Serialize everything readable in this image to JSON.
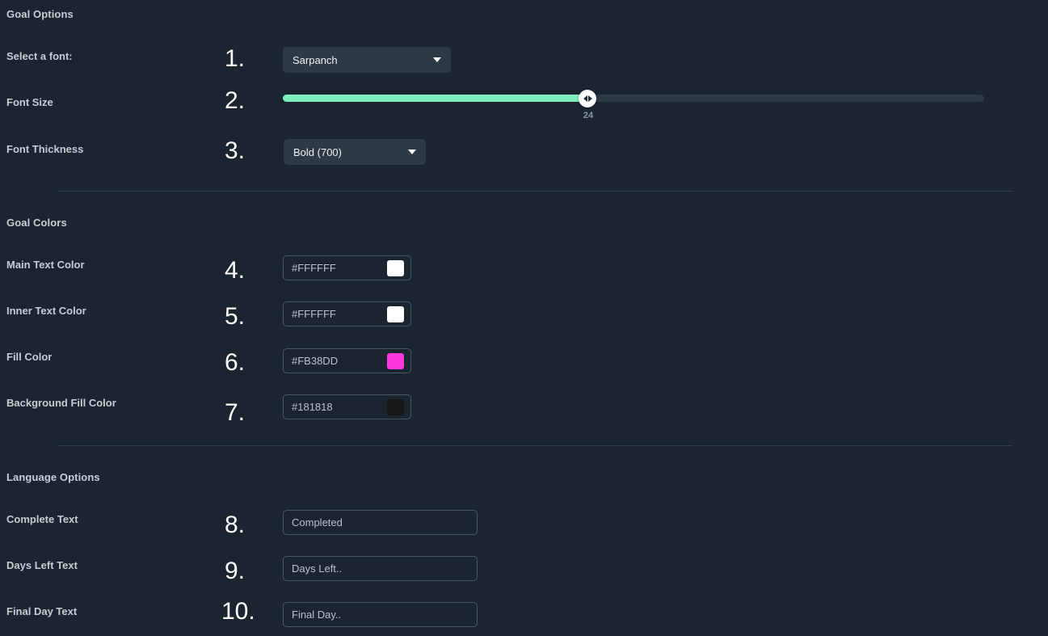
{
  "colors": {
    "page_background": "#1a2530",
    "accent_slider": "#7fefc0",
    "select_background": "#2d3945",
    "divider": "#2f3d49",
    "label_text": "#c5ccd3"
  },
  "sections": {
    "goal_options": {
      "title": "Goal Options"
    },
    "goal_colors": {
      "title": "Goal Colors"
    },
    "language_options": {
      "title": "Language Options"
    }
  },
  "rows": {
    "select_font": {
      "label": "Select a font:",
      "marker": "1.",
      "value": "Sarpanch",
      "icon": "chevron-down-icon"
    },
    "font_size": {
      "label": "Font Size",
      "marker": "2.",
      "value": "24",
      "min": "8",
      "max": "100",
      "percent": 43
    },
    "font_thickness": {
      "label": "Font Thickness",
      "marker": "3.",
      "value": "Bold (700)",
      "icon": "chevron-down-icon"
    },
    "main_text_color": {
      "label": "Main Text Color",
      "marker": "4.",
      "value": "#FFFFFF",
      "swatch": "#FFFFFF"
    },
    "inner_text_color": {
      "label": "Inner Text Color",
      "marker": "5.",
      "value": "#FFFFFF",
      "swatch": "#FFFFFF"
    },
    "fill_color": {
      "label": "Fill Color",
      "marker": "6.",
      "value": "#FB38DD",
      "swatch": "#FB38DD"
    },
    "background_fill_color": {
      "label": "Background Fill Color",
      "marker": "7.",
      "value": "#181818",
      "swatch": "#181818"
    },
    "complete_text": {
      "label": "Complete Text",
      "marker": "8.",
      "value": "Completed"
    },
    "days_left_text": {
      "label": "Days Left Text",
      "marker": "9.",
      "value": "Days Left.."
    },
    "final_day_text": {
      "label": "Final Day Text",
      "marker": "10.",
      "value": "Final Day.."
    }
  }
}
